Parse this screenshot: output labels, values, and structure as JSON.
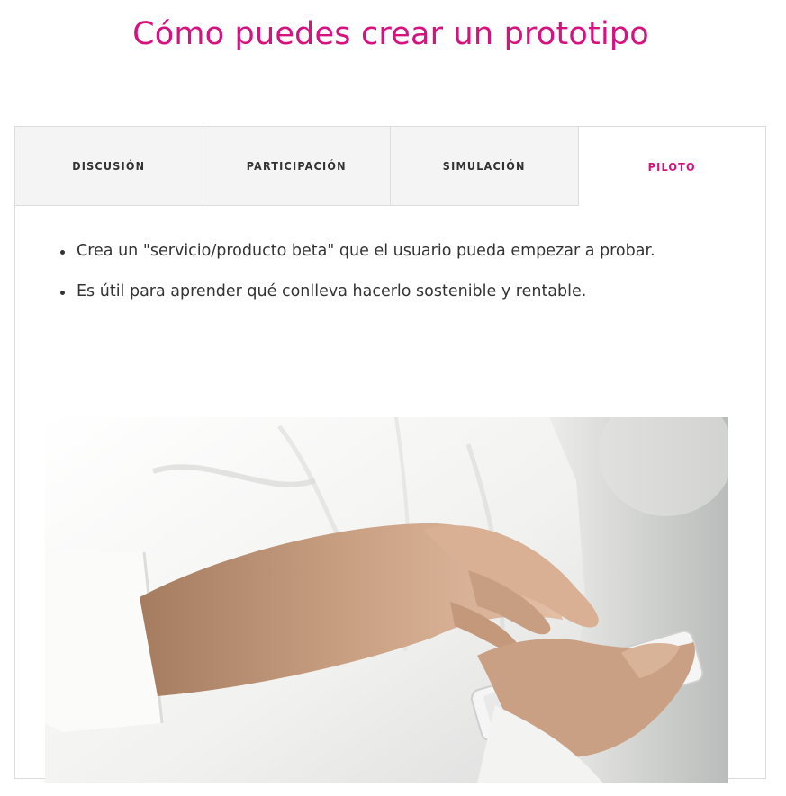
{
  "page": {
    "title": "Cómo puedes crear un prototipo",
    "accent_color": "#d6127e"
  },
  "tabs": [
    {
      "label": "DISCUSIÓN",
      "active": false
    },
    {
      "label": "PARTICIPACIÓN",
      "active": false
    },
    {
      "label": "SIMULACIÓN",
      "active": false
    },
    {
      "label": "PILOTO",
      "active": true
    }
  ],
  "panel": {
    "bullets": [
      "Crea un \"servicio/producto beta\" que el usuario pueda empezar a probar.",
      "Es útil para aprender qué conlleva hacerlo sostenible y rentable."
    ],
    "image": {
      "icon": "photo-person-using-smartphone"
    }
  }
}
